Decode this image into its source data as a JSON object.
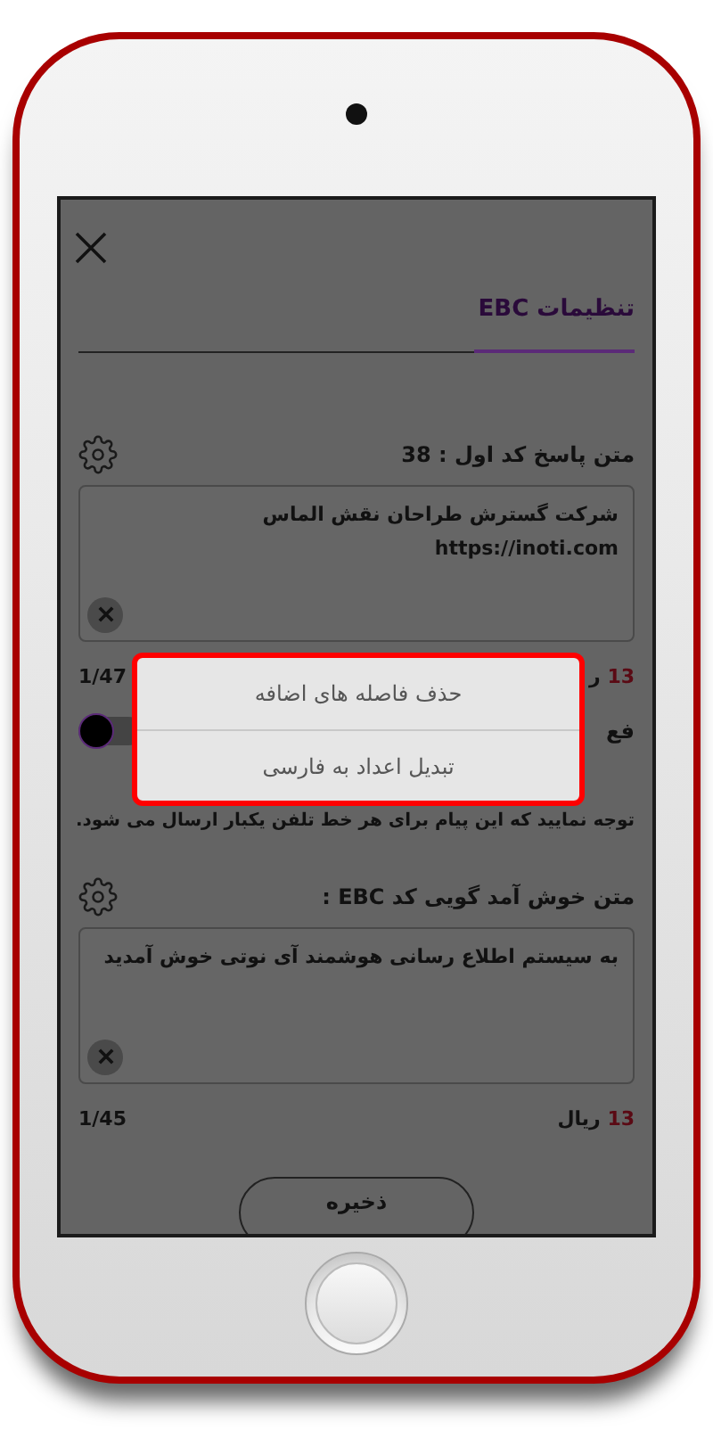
{
  "header": {
    "title": "تنظیمات EBC"
  },
  "sections": [
    {
      "label": "متن پاسخ کد اول : 38",
      "text": "شرکت گسترش طراحان نقش الماس\nhttps://inoti.com",
      "price": {
        "amount": "13",
        "unit": "ر"
      },
      "counter": "1/47"
    },
    {
      "label": "متن خوش آمد گویی کد EBC :",
      "text": "به سیستم اطلاع رسانی هوشمند آی نوتی خوش آمدید",
      "price": {
        "amount": "13",
        "unit": "ریال"
      },
      "counter": "1/45"
    }
  ],
  "toggle": {
    "label": "فع",
    "on": false
  },
  "note": "توجه نمایید که این پیام برای هر خط تلفن یکبار ارسال می شود.",
  "popup": {
    "items": [
      {
        "label": "حذف فاصله های اضافه"
      },
      {
        "label": "تبدیل اعداد به فارسی"
      }
    ]
  },
  "save_button": "ذخیره"
}
